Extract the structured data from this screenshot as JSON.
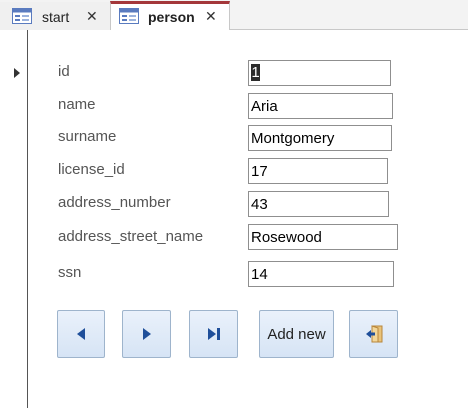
{
  "tabs": [
    {
      "label": "start",
      "close_glyph": "✕",
      "icon": "form-icon",
      "active": false
    },
    {
      "label": "person",
      "close_glyph": "✕",
      "icon": "form-icon",
      "active": true
    }
  ],
  "form": {
    "fields": {
      "id": {
        "label": "id",
        "value": "1"
      },
      "name": {
        "label": "name",
        "value": "Aria"
      },
      "surname": {
        "label": "surname",
        "value": "Montgomery"
      },
      "license_id": {
        "label": "license_id",
        "value": "17"
      },
      "address_number": {
        "label": "address_number",
        "value": "43"
      },
      "address_street_name": {
        "label": "address_street_name",
        "value": "Rosewood"
      },
      "ssn": {
        "label": "ssn",
        "value": "14"
      }
    }
  },
  "buttons": {
    "previous_icon": "previous-record-icon",
    "next_icon": "next-record-icon",
    "last_icon": "last-record-icon",
    "add_new_label": "Add new",
    "close_icon": "close-form-icon"
  },
  "colors": {
    "active_tab_accent": "#a4373a",
    "button_fill": "#d6e4f5",
    "nav_icon": "#1f4f9a"
  }
}
